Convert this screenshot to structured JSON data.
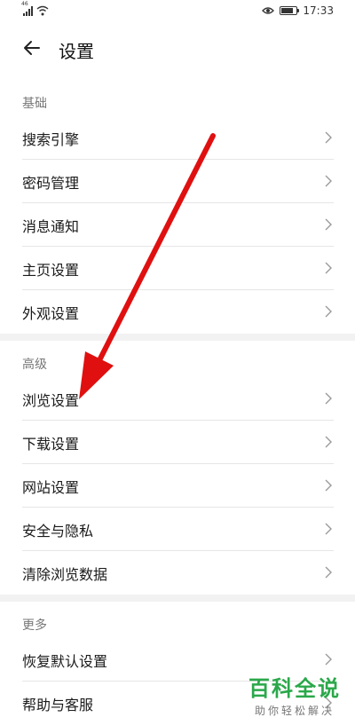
{
  "status_bar": {
    "network_type": "46",
    "time": "17:33",
    "battery_level": 0.85
  },
  "header": {
    "title": "设置"
  },
  "sections": {
    "basic": {
      "label": "基础",
      "items": [
        {
          "label": "搜索引擎"
        },
        {
          "label": "密码管理"
        },
        {
          "label": "消息通知"
        },
        {
          "label": "主页设置"
        },
        {
          "label": "外观设置"
        }
      ]
    },
    "advanced": {
      "label": "高级",
      "items": [
        {
          "label": "浏览设置"
        },
        {
          "label": "下载设置"
        },
        {
          "label": "网站设置"
        },
        {
          "label": "安全与隐私"
        },
        {
          "label": "清除浏览数据"
        }
      ]
    },
    "more": {
      "label": "更多",
      "items": [
        {
          "label": "恢复默认设置"
        },
        {
          "label": "帮助与客服"
        }
      ]
    }
  },
  "annotation": {
    "arrow_color": "#e01010"
  },
  "watermark": {
    "title": "百科全说",
    "subtitle": "助你轻松解决",
    "color": "#2aa84a"
  }
}
